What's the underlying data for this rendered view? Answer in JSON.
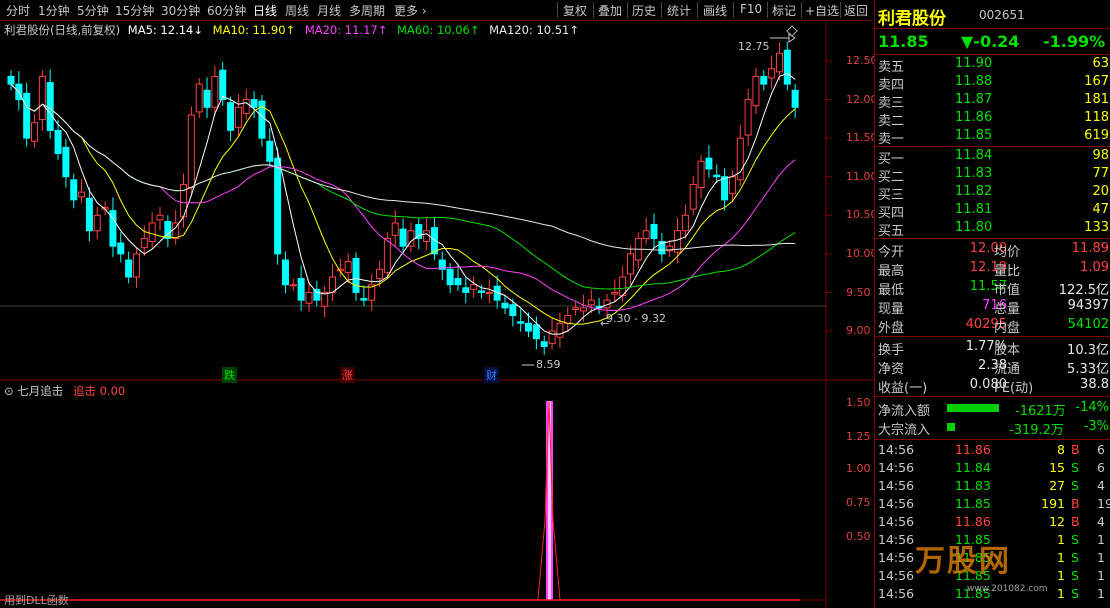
{
  "toolbar": {
    "periods": [
      "分时",
      "1分钟",
      "5分钟",
      "15分钟",
      "30分钟",
      "60分钟",
      "日线",
      "周线",
      "月线",
      "多周期"
    ],
    "active_period": "日线",
    "more": "更多",
    "right_buttons": [
      "复权",
      "叠加",
      "历史",
      "统计",
      "画线",
      "F10",
      "标记",
      "+自选",
      "返回"
    ]
  },
  "stock": {
    "name": "利君股份",
    "code": "002651",
    "price": "11.85",
    "change": "▼-0.24",
    "change_pct": "-1.99%"
  },
  "main_chart": {
    "title": "利君股份(日线,前复权)",
    "ma": [
      {
        "label": "MA5: 12.14↓",
        "color": "#ffffff"
      },
      {
        "label": "MA10: 11.90↑",
        "color": "#ffff00"
      },
      {
        "label": "MA20: 11.17↑",
        "color": "#ff40ff"
      },
      {
        "label": "MA60: 10.06↑",
        "color": "#00e000"
      },
      {
        "label": "MA120: 10.51↑",
        "color": "#e8e8e8"
      }
    ],
    "y_ticks": [
      "12.50",
      "12.00",
      "11.50",
      "11.00",
      "10.50",
      "10.00",
      "9.50",
      "9.00"
    ],
    "annotations": {
      "high": "12.75",
      "low": "8.59",
      "range": "9.30 - 9.32"
    },
    "markers": [
      {
        "text": "跌",
        "color": "#00e000"
      },
      {
        "text": "涨",
        "color": "#ff4040"
      },
      {
        "text": "财",
        "color": "#4080ff"
      }
    ]
  },
  "indicator": {
    "title": "七月追击",
    "label": "追击",
    "value": "0.00",
    "y_ticks": [
      "1.50",
      "1.25",
      "1.00",
      "0.75",
      "0.50"
    ],
    "footer": "用到DLL函数"
  },
  "order_book": {
    "asks": [
      {
        "label": "卖五",
        "price": "11.90",
        "vol": "63"
      },
      {
        "label": "卖四",
        "price": "11.88",
        "vol": "167"
      },
      {
        "label": "卖三",
        "price": "11.87",
        "vol": "181"
      },
      {
        "label": "卖二",
        "price": "11.86",
        "vol": "118"
      },
      {
        "label": "卖一",
        "price": "11.85",
        "vol": "619"
      }
    ],
    "bids": [
      {
        "label": "买一",
        "price": "11.84",
        "vol": "98"
      },
      {
        "label": "买二",
        "price": "11.83",
        "vol": "77"
      },
      {
        "label": "买三",
        "price": "11.82",
        "vol": "20"
      },
      {
        "label": "买四",
        "price": "11.81",
        "vol": "47"
      },
      {
        "label": "买五",
        "price": "11.80",
        "vol": "133"
      }
    ]
  },
  "quote": {
    "open": {
      "l": "今开",
      "v": "12.00"
    },
    "avg": {
      "l": "均价",
      "v": "11.89"
    },
    "high": {
      "l": "最高",
      "v": "12.19"
    },
    "vr": {
      "l": "量比",
      "v": "1.09"
    },
    "low": {
      "l": "最低",
      "v": "11.57"
    },
    "amt": {
      "l": "市值",
      "v": "122.5亿"
    },
    "cur": {
      "l": "现量",
      "v": "716"
    },
    "tot": {
      "l": "总量",
      "v": "94397"
    },
    "outer": {
      "l": "外盘",
      "v": "40295"
    },
    "inner": {
      "l": "内盘",
      "v": "54102"
    },
    "turn": {
      "l": "换手",
      "v": "1.77%"
    },
    "cap": {
      "l": "股本",
      "v": "10.3亿"
    },
    "nav": {
      "l": "净资",
      "v": "2.38"
    },
    "flt": {
      "l": "流通",
      "v": "5.33亿"
    },
    "eps": {
      "l": "收益(一)",
      "v": "0.080"
    },
    "pe": {
      "l": "PE(动)",
      "v": "38.8"
    }
  },
  "flow": {
    "net": {
      "l": "净流入额",
      "v": "-1621万",
      "pct": "-14%"
    },
    "big": {
      "l": "大宗流入",
      "v": "-319.2万",
      "pct": "-3%"
    }
  },
  "ticks": [
    {
      "t": "14:56",
      "p": "11.86",
      "v": "8",
      "d": "B",
      "n": "6"
    },
    {
      "t": "14:56",
      "p": "11.84",
      "v": "15",
      "d": "S",
      "n": "6"
    },
    {
      "t": "14:56",
      "p": "11.83",
      "v": "27",
      "d": "S",
      "n": "4"
    },
    {
      "t": "14:56",
      "p": "11.85",
      "v": "191",
      "d": "B",
      "n": "19"
    },
    {
      "t": "14:56",
      "p": "11.86",
      "v": "12",
      "d": "B",
      "n": "4"
    },
    {
      "t": "14:56",
      "p": "11.85",
      "v": "1",
      "d": "S",
      "n": "1"
    },
    {
      "t": "14:56",
      "p": "11.85",
      "v": "1",
      "d": "S",
      "n": "1"
    },
    {
      "t": "14:56",
      "p": "11.85",
      "v": "1",
      "d": "S",
      "n": "1"
    },
    {
      "t": "14:56",
      "p": "11.85",
      "v": "1",
      "d": "S",
      "n": "1"
    }
  ],
  "watermark": {
    "text": "万股网",
    "url": "www.201082.com"
  },
  "colors": {
    "up": "#ff4040",
    "down": "#00ffff",
    "bg": "#000000",
    "border": "#800000"
  }
}
